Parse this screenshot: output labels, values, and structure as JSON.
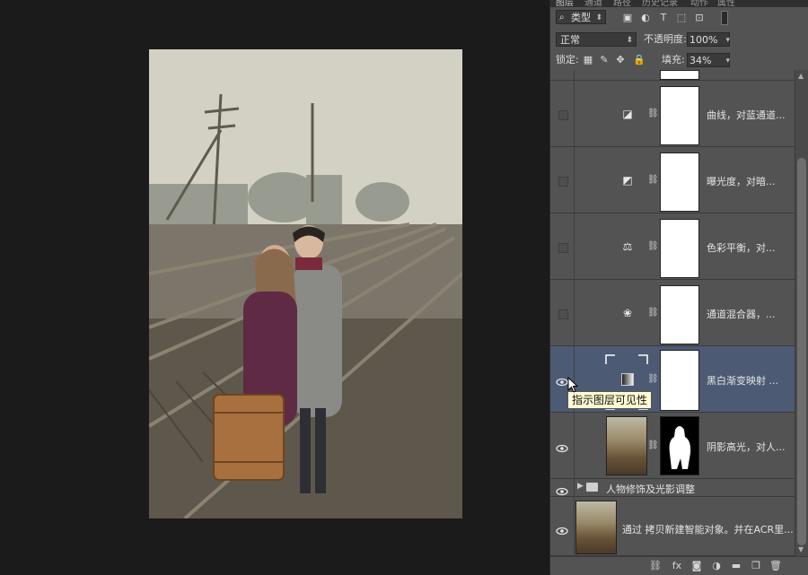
{
  "panel": {
    "tabs": [
      "图层",
      "通道",
      "路径",
      "历史记录",
      "动作",
      "属性"
    ],
    "filter": {
      "label": "类型"
    },
    "blend_mode": "正常",
    "opacity_label": "不透明度:",
    "opacity_value": "100%",
    "lock_label": "锁定:",
    "fill_label": "填充:",
    "fill_value": "34%"
  },
  "layers": [
    {
      "name": "曲线，对蓝通道...",
      "icon": "curves-icon",
      "visible": false,
      "selected": false
    },
    {
      "name": "曝光度，对暗...",
      "icon": "exposure-icon",
      "visible": false,
      "selected": false
    },
    {
      "name": "色彩平衡，对...",
      "icon": "color-balance-icon",
      "visible": false,
      "selected": false
    },
    {
      "name": "通道混合器，...",
      "icon": "channel-mixer-icon",
      "visible": false,
      "selected": false
    },
    {
      "name": "黑白渐变映射 ...",
      "icon": "gradient-map-icon",
      "visible": true,
      "selected": true
    },
    {
      "name": "阴影高光，对人...",
      "icon": "smart-object-thumb",
      "visible": true,
      "selected": false
    },
    {
      "name": "人物修饰及光影调整",
      "icon": "folder-icon",
      "visible": true,
      "selected": false
    },
    {
      "name": "通过 拷贝新建智能对象。并在ACR里...",
      "icon": "smart-object-thumb",
      "visible": true,
      "selected": false
    }
  ],
  "tooltip": "指示图层可见性",
  "colors": {
    "panel_bg": "#535353",
    "selected_bg": "#4d5a74",
    "canvas_bg": "#1b1b1b"
  }
}
